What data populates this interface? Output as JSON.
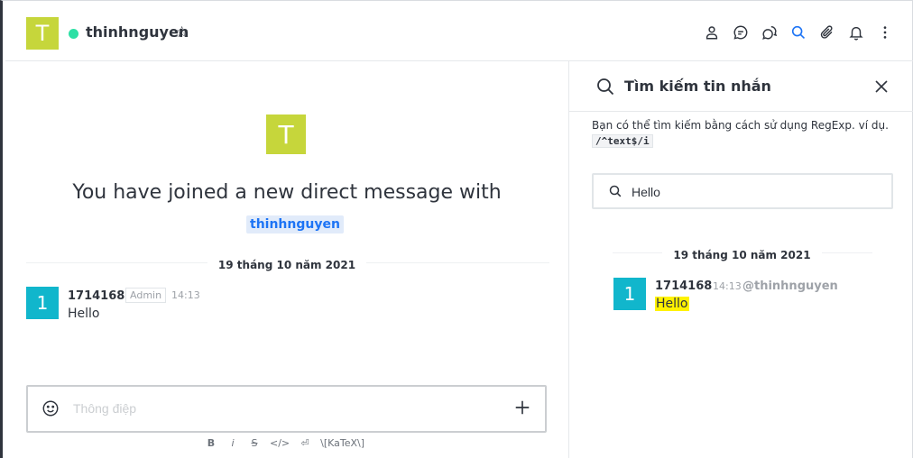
{
  "header": {
    "avatar_letter": "T",
    "username": "thinhnguyen",
    "status_color": "#2de0a5",
    "star_icon": "☆",
    "toolbar_icons": [
      "user-info-icon",
      "discussion-icon",
      "threads-icon",
      "search-icon",
      "attachment-icon",
      "notifications-icon",
      "kebab-menu-icon"
    ]
  },
  "main": {
    "join_avatar_letter": "T",
    "join_text": "You have joined a new direct message with",
    "mention": "thinhnguyen",
    "date_divider": "19 tháng 10 năm 2021",
    "message": {
      "avatar_letter": "1",
      "username": "1714168",
      "role": "Admin",
      "time": "14:13",
      "text": "Hello"
    },
    "composer": {
      "placeholder": "Thông điệp"
    },
    "format_bar": {
      "bold": "B",
      "italic": "i",
      "strike": "S",
      "code": "</>",
      "multiline": "⏎",
      "katex": "\\[KaTeX\\]"
    }
  },
  "panel": {
    "title": "Tìm kiếm tin nhắn",
    "hint_text": "Bạn có thể tìm kiếm bằng cách sử dụng RegExp. ví dụ.",
    "hint_code": "/^text$/i",
    "search_value": "Hello",
    "date_divider": "19 tháng 10 năm 2021",
    "result": {
      "avatar_letter": "1",
      "username": "1714168",
      "time": "14:13",
      "handle": "@thinhnguyen",
      "text": "Hello"
    }
  },
  "colors": {
    "accent": "#1d74f5",
    "avatar_t": "#c6d63b",
    "avatar_1": "#11b6cc",
    "highlight": "#fff200"
  }
}
